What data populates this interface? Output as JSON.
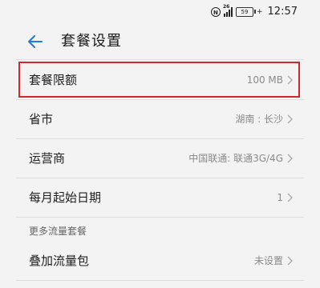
{
  "status_bar": {
    "hd_badge": "N",
    "signal_tag": "26",
    "battery": "59",
    "charge": "+",
    "time": "12:57"
  },
  "header": {
    "title": "套餐设置"
  },
  "rows": [
    {
      "label": "套餐限额",
      "value": "100 MB"
    },
    {
      "label": "省市",
      "value": "湖南 : 长沙"
    },
    {
      "label": "运营商",
      "value": "中国联通: 联通3G/4G"
    },
    {
      "label": "每月起始日期",
      "value": "1"
    }
  ],
  "section": {
    "title": "更多流量套餐"
  },
  "section_rows": [
    {
      "label": "叠加流量包",
      "value": "未设置"
    }
  ],
  "colors": {
    "background": "#f3f3f3",
    "accent": "#1f7ae0",
    "highlight": "#d6262b"
  },
  "icons": {
    "back": "back-arrow-icon",
    "chevron": "chevron-right-icon"
  }
}
